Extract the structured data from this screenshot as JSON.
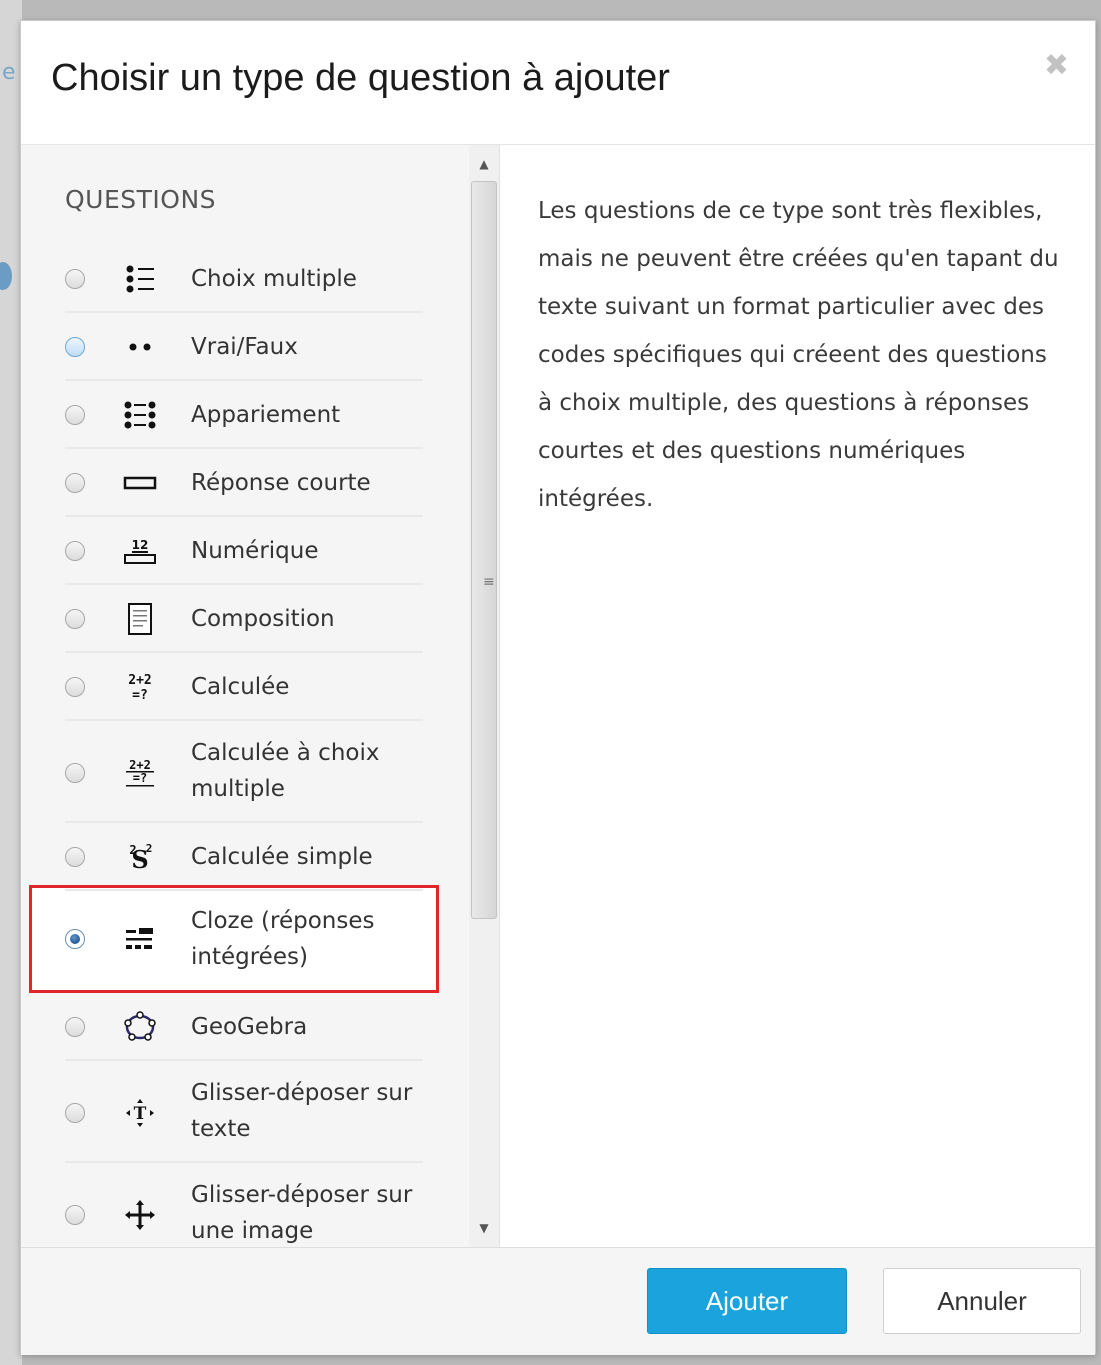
{
  "dialog": {
    "title": "Choisir un type de question à ajouter",
    "close_icon": "close-icon"
  },
  "questions": {
    "section_label": "QUESTIONS",
    "selected_index": 9,
    "items": [
      {
        "label": "Choix multiple",
        "icon": "multiple-choice-icon"
      },
      {
        "label": "Vrai/Faux",
        "icon": "true-false-icon"
      },
      {
        "label": "Appariement",
        "icon": "matching-icon"
      },
      {
        "label": "Réponse courte",
        "icon": "short-answer-icon"
      },
      {
        "label": "Numérique",
        "icon": "numerical-icon"
      },
      {
        "label": "Composition",
        "icon": "essay-icon"
      },
      {
        "label": "Calculée",
        "icon": "calculated-icon"
      },
      {
        "label": "Calculée à choix multiple",
        "icon": "calculated-multichoice-icon"
      },
      {
        "label": "Calculée simple",
        "icon": "calculated-simple-icon"
      },
      {
        "label": "Cloze (réponses intégrées)",
        "icon": "cloze-icon"
      },
      {
        "label": "GeoGebra",
        "icon": "geogebra-icon"
      },
      {
        "label": "Glisser-déposer sur texte",
        "icon": "drag-drop-text-icon"
      },
      {
        "label": "Glisser-déposer sur une image",
        "icon": "drag-drop-image-icon"
      }
    ]
  },
  "description": {
    "text": "Les questions de ce type sont très flexibles, mais ne peuvent être créées qu'en tapant du texte suivant un format particulier avec des codes spécifiques qui créeent des questions à choix multiple, des questions à réponses courtes et des questions numériques intégrées."
  },
  "footer": {
    "add_label": "Ajouter",
    "cancel_label": "Annuler"
  },
  "colors": {
    "primary": "#1aa3dd",
    "highlight_border": "#e0262a"
  }
}
